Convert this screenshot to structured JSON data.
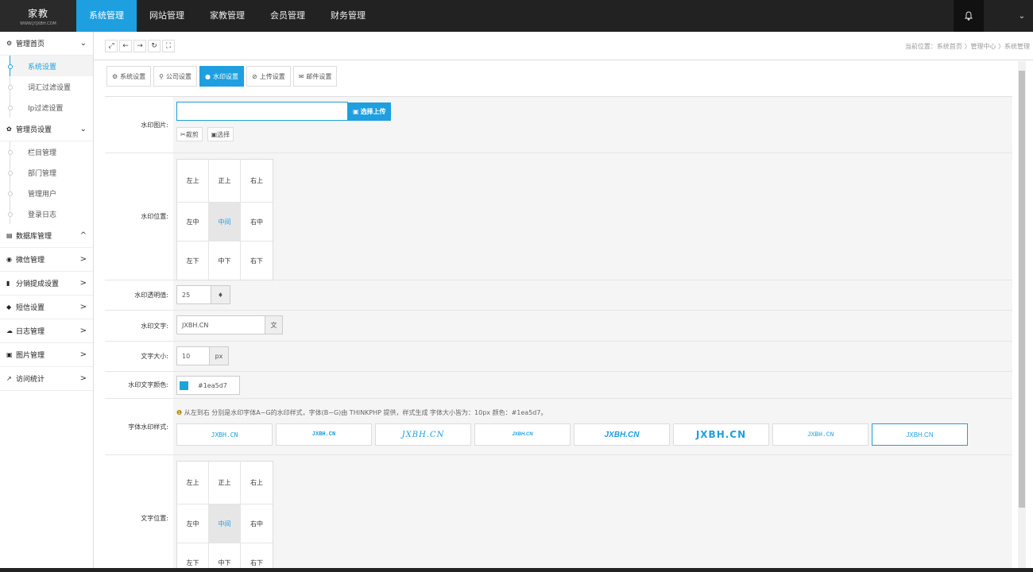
{
  "header": {
    "logo_title": "家教",
    "logo_sub": "WWW.JYJXBH.COM",
    "nav": [
      {
        "label": "系统管理",
        "active": true
      },
      {
        "label": "网站管理",
        "active": false
      },
      {
        "label": "家教管理",
        "active": false
      },
      {
        "label": "会员管理",
        "active": false
      },
      {
        "label": "财务管理",
        "active": false
      }
    ],
    "bell_icon": "bell-icon",
    "user_chevron": "⌄"
  },
  "sidebar": {
    "groups": [
      {
        "label": "管理首页",
        "icon": "cogs-icon",
        "caret": "⌄",
        "items": [
          {
            "label": "系统设置",
            "active": true
          },
          {
            "label": "词汇过滤设置"
          },
          {
            "label": "Ip过滤设置"
          }
        ]
      },
      {
        "label": "管理员设置",
        "icon": "gear-icon",
        "caret": "⌄",
        "items": [
          {
            "label": "栏目管理"
          },
          {
            "label": "部门管理"
          },
          {
            "label": "管理用户"
          },
          {
            "label": "登录日志"
          }
        ]
      },
      {
        "label": "数据库管理",
        "icon": "database-icon",
        "caret": "^",
        "items": []
      },
      {
        "label": "微信管理",
        "icon": "wechat-icon",
        "caret": ">",
        "items": []
      },
      {
        "label": "分销提成设置",
        "icon": "bar-chart-icon",
        "caret": ">",
        "items": []
      },
      {
        "label": "短信设置",
        "icon": "comment-icon",
        "caret": ">",
        "items": []
      },
      {
        "label": "日志管理",
        "icon": "cloud-icon",
        "caret": ">",
        "items": []
      },
      {
        "label": "图片管理",
        "icon": "picture-icon",
        "caret": ">",
        "items": []
      },
      {
        "label": "访问统计",
        "icon": "line-chart-icon",
        "caret": ">",
        "items": []
      }
    ]
  },
  "toolbar": {
    "breadcrumb": "当前位置：系统首页 〉管理中心 〉系统管理"
  },
  "tabs": [
    {
      "label": "系统设置",
      "icon": "⚙",
      "active": false
    },
    {
      "label": "公司设置",
      "icon": "⚲",
      "active": false
    },
    {
      "label": "水印设置",
      "icon": "●",
      "active": true
    },
    {
      "label": "上传设置",
      "icon": "⊘",
      "active": false
    },
    {
      "label": "邮件设置",
      "icon": "✉",
      "active": false
    }
  ],
  "form": {
    "wm_image": {
      "label": "水印图片:",
      "value": "",
      "upload_label": "选择上传",
      "crop_label": "裁剪",
      "select_label": "选择"
    },
    "wm_position": {
      "label": "水印位置:",
      "cells": [
        "左上",
        "正上",
        "右上",
        "左中",
        "中间",
        "右中",
        "左下",
        "中下",
        "右下"
      ],
      "selected": 4
    },
    "wm_opacity": {
      "label": "水印透明值:",
      "value": "25",
      "addon": "♦"
    },
    "wm_text": {
      "label": "水印文字:",
      "value": "JXBH.CN",
      "addon": "文"
    },
    "font_size": {
      "label": "文字大小:",
      "value": "10",
      "addon": "px"
    },
    "text_color": {
      "label": "水印文字颜色:",
      "value": "#1ea5d7",
      "swatch": "#1ea5d7"
    },
    "font_style": {
      "label": "字体水印样式:",
      "tip": "从左到右 分别是水印字体A~G的水印样式，字体(B~G)由 THINKPHP 提供，样式生成 字体大小皆为：10px 颜色：#1ea5d7。",
      "samples": [
        "JXBH.CN",
        "JXBH.CN",
        "JXBH.CN",
        "JXBH.CN",
        "JXBH.CN",
        "JXBH.CN",
        "JXBH.CN",
        "JXBH.CN"
      ],
      "selected": 7
    },
    "text_position": {
      "label": "文字位置:",
      "cells": [
        "左上",
        "正上",
        "右上",
        "左中",
        "中间",
        "右中",
        "左下",
        "中下",
        "右下"
      ],
      "selected": 4
    }
  },
  "colors": {
    "accent": "#1e9fe0",
    "topbar": "#222222"
  }
}
